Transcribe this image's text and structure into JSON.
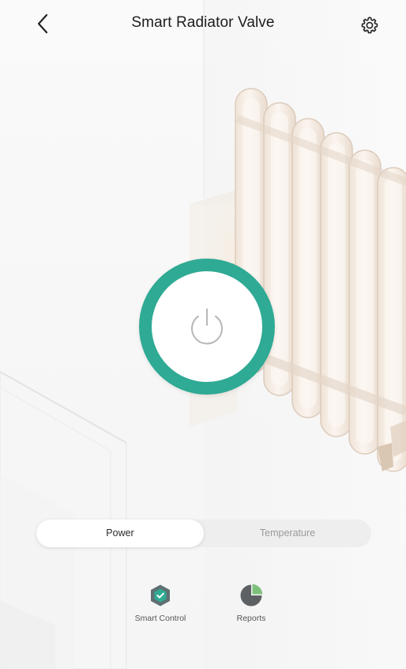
{
  "header": {
    "title": "Smart Radiator Valve",
    "back_icon": "chevron-left-icon",
    "settings_icon": "gear-icon"
  },
  "power": {
    "icon": "power-icon",
    "ring_color": "#2faa94"
  },
  "tabs": [
    {
      "label": "Power",
      "selected": true
    },
    {
      "label": "Temperature",
      "selected": false
    }
  ],
  "features": [
    {
      "label": "Smart Control",
      "icon": "smart-control-shield-icon",
      "color": "#2faa94"
    },
    {
      "label": "Reports",
      "icon": "pie-chart-icon",
      "color": "#7cc07a"
    }
  ],
  "colors": {
    "accent": "#2faa94",
    "background": "#f7f7f7",
    "radiator": "#f2e6da"
  }
}
